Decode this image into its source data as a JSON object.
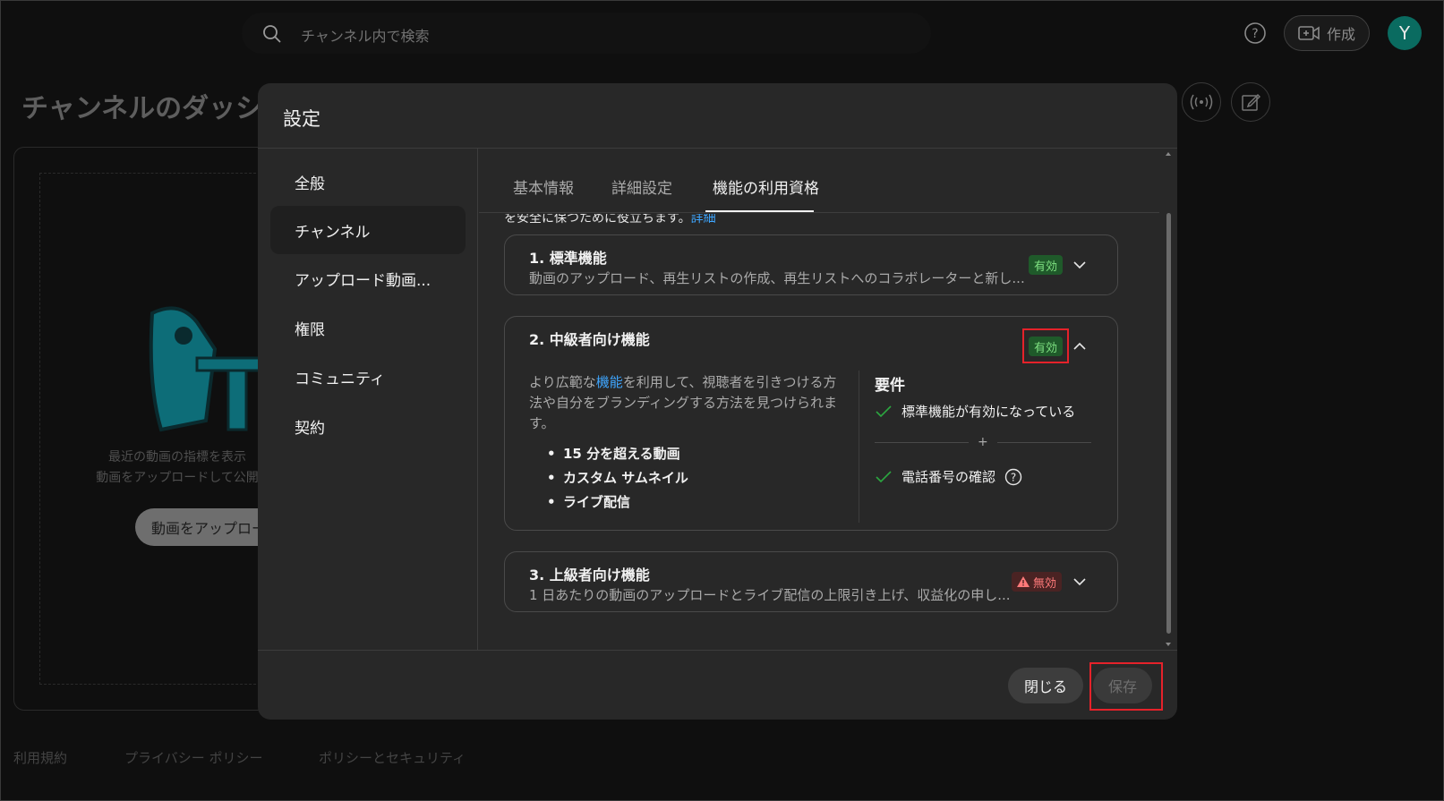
{
  "topbar": {
    "search_placeholder": "チャンネル内で検索",
    "create_label": "作成",
    "avatar_letter": "Y"
  },
  "background": {
    "dashboard_title": "チャンネルのダッシュ",
    "card_text_1": "最近の動画の指標を表示",
    "card_text_2": "動画をアップロードして公開",
    "upload_button": "動画をアップロー",
    "footer": [
      "利用規約",
      "プライバシー ポリシー",
      "ポリシーとセキュリティ"
    ]
  },
  "modal": {
    "title": "設定",
    "sidebar": [
      {
        "label": "全般"
      },
      {
        "label": "チャンネル"
      },
      {
        "label": "アップロード動画..."
      },
      {
        "label": "権限"
      },
      {
        "label": "コミュニティ"
      },
      {
        "label": "契約"
      }
    ],
    "tabs": [
      "基本情報",
      "詳細設定",
      "機能の利用資格"
    ],
    "cut_text": "を安全に保つために役立ちます。",
    "cut_link": "詳細",
    "features": {
      "f1": {
        "title": "1. 標準機能",
        "desc": "動画のアップロード、再生リストの作成、再生リストへのコラボレーターと新し...",
        "status": "有効"
      },
      "f2": {
        "title": "2. 中級者向け機能",
        "status": "有効",
        "desc_pre": "より広範な",
        "desc_link": "機能",
        "desc_post_1": "を利用して、視聴者を引きつける方",
        "desc_line_2": "法や自分をブランディングする方法を見つけられま",
        "desc_line_3": "す。",
        "bullets": [
          "15 分を超える動画",
          "カスタム サムネイル",
          "ライブ配信"
        ],
        "requirements_title": "要件",
        "req_1": "標準機能が有効になっている",
        "plus": "+",
        "req_2": "電話番号の確認"
      },
      "f3": {
        "title": "3. 上級者向け機能",
        "desc": "1 日あたりの動画のアップロードとライブ配信の上限引き上げ、収益化の申し...",
        "status": "無効"
      }
    },
    "close_button": "閉じる",
    "save_button": "保存"
  }
}
